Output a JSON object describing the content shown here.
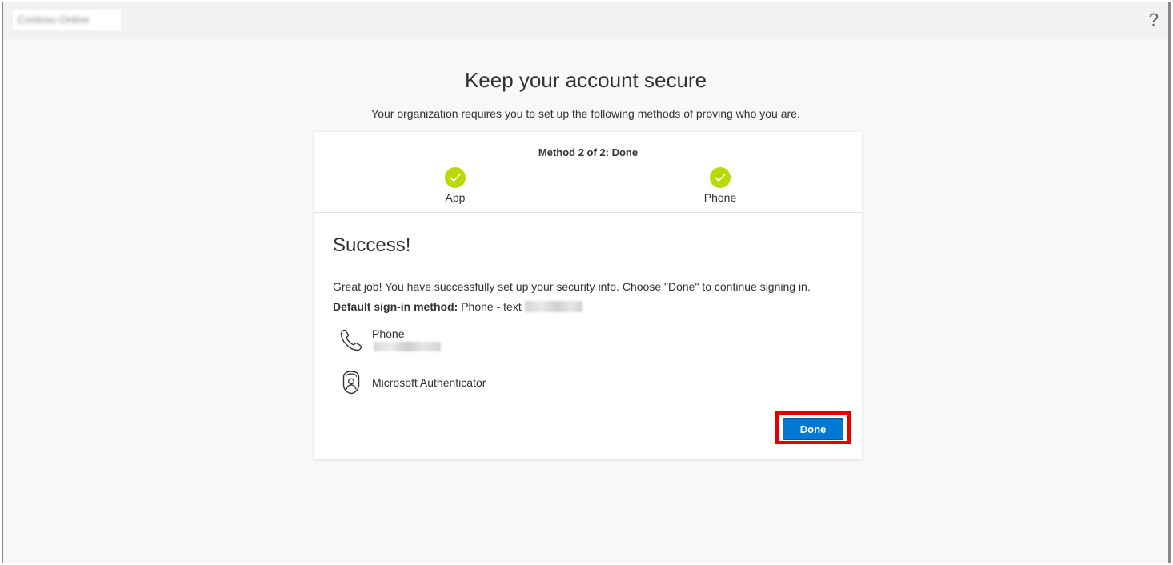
{
  "header": {
    "org_name": "Contoso Online",
    "help_icon": "?"
  },
  "page": {
    "title": "Keep your account secure",
    "subtitle": "Your organization requires you to set up the following methods of proving who you are."
  },
  "progress": {
    "title": "Method 2 of 2: Done",
    "steps": [
      {
        "label": "App",
        "status": "complete",
        "icon": "check-icon"
      },
      {
        "label": "Phone",
        "status": "complete",
        "icon": "check-icon"
      }
    ]
  },
  "result": {
    "heading": "Success!",
    "message": "Great job! You have successfully set up your security info. Choose \"Done\" to continue signing in.",
    "default_label": "Default sign-in method:",
    "default_value": "Phone - text"
  },
  "methods": [
    {
      "name": "Phone",
      "icon": "phone-icon"
    },
    {
      "name": "Microsoft Authenticator",
      "icon": "authenticator-icon"
    }
  ],
  "actions": {
    "done_label": "Done"
  },
  "colors": {
    "accent": "#0078d4",
    "step_complete": "#bad80a",
    "highlight": "#e00000"
  }
}
